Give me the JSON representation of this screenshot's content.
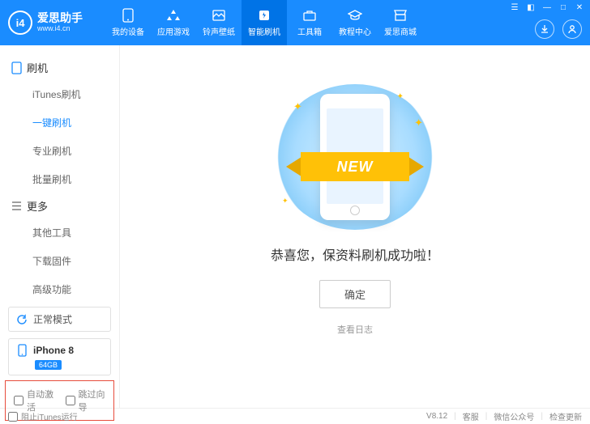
{
  "app": {
    "title": "爱思助手",
    "url": "www.i4.cn",
    "logo_text": "i4"
  },
  "tabs": [
    {
      "label": "我的设备"
    },
    {
      "label": "应用游戏"
    },
    {
      "label": "铃声壁纸"
    },
    {
      "label": "智能刷机"
    },
    {
      "label": "工具箱"
    },
    {
      "label": "教程中心"
    },
    {
      "label": "爱思商城"
    }
  ],
  "sidebar": {
    "group1": {
      "title": "刷机",
      "items": [
        "iTunes刷机",
        "一键刷机",
        "专业刷机",
        "批量刷机"
      ]
    },
    "group2": {
      "title": "更多",
      "items": [
        "其他工具",
        "下载固件",
        "高级功能"
      ]
    }
  },
  "status": {
    "mode": "正常模式",
    "device": "iPhone 8",
    "storage": "64GB"
  },
  "options": {
    "auto_activate": "自动激活",
    "skip_guide": "跳过向导"
  },
  "main": {
    "new_label": "NEW",
    "success": "恭喜您，保资料刷机成功啦！",
    "ok": "确定",
    "view_log": "查看日志"
  },
  "footer": {
    "block_itunes": "阻止iTunes运行",
    "version": "V8.12",
    "support": "客服",
    "wechat": "微信公众号",
    "update": "检查更新"
  }
}
